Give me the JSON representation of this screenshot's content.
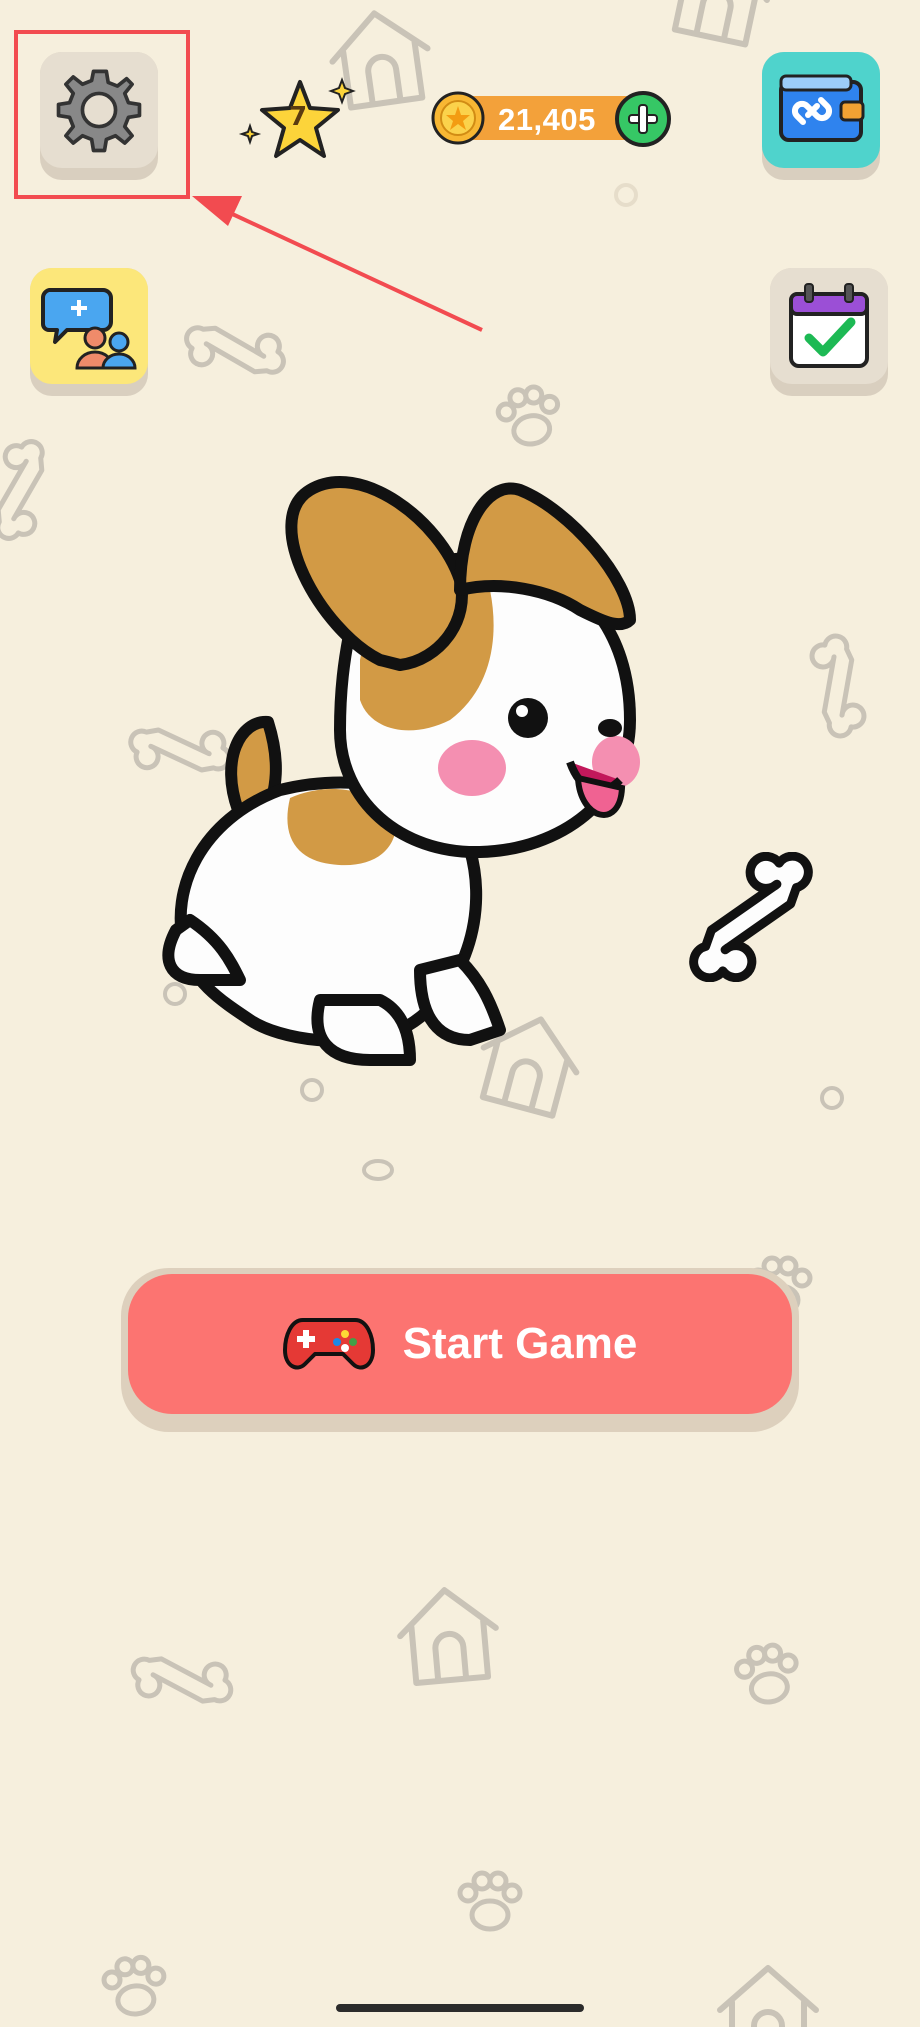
{
  "header": {
    "settings_icon": "gear-icon",
    "level": "7",
    "coins": "21,405",
    "add_coins_icon": "plus-icon",
    "wallet_icon": "wallet-link-icon"
  },
  "side": {
    "friends_icon": "add-friends-chat-icon",
    "daily_icon": "calendar-check-icon"
  },
  "main": {
    "start_label": "Start Game",
    "start_icon": "gamepad-icon"
  },
  "colors": {
    "background": "#f6efdd",
    "start_button": "#fc7471",
    "coin_pill": "#f3a13a",
    "annotation": "#f24b50",
    "wallet_tile": "#4fd3cc",
    "friends_tile": "#fce77a"
  }
}
